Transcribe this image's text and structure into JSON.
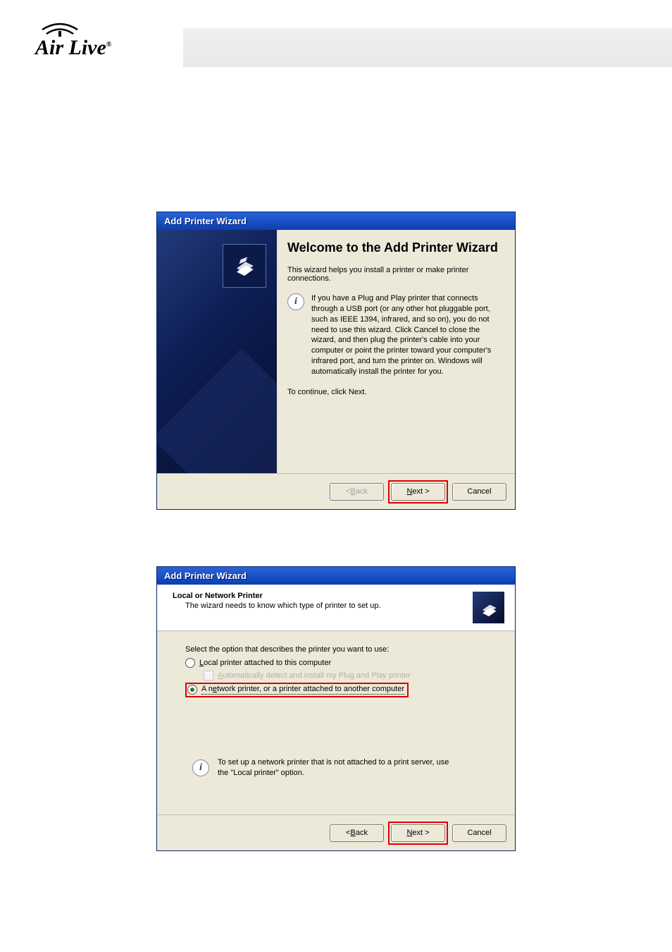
{
  "brand": {
    "name": "Air Live"
  },
  "dialog1": {
    "title": "Add Printer Wizard",
    "heading": "Welcome to the Add Printer Wizard",
    "intro": "This wizard helps you install a printer or make printer connections.",
    "info": "If you have a Plug and Play printer that connects through a USB port (or any other hot pluggable port, such as IEEE 1394, infrared, and so on), you do not need to use this wizard. Click Cancel to close the wizard, and then plug the printer's cable into your computer or point the printer toward your computer's infrared port, and turn the printer on. Windows will automatically install the printer for you.",
    "continue": "To continue, click Next.",
    "back": "< Back",
    "next": "Next >",
    "cancel": "Cancel"
  },
  "dialog2": {
    "title": "Add Printer Wizard",
    "subheader_title": "Local or Network Printer",
    "subheader_desc": "The wizard needs to know which type of printer to set up.",
    "prompt": "Select the option that describes the printer you want to use:",
    "opt_local": "Local printer attached to this computer",
    "opt_autodetect": "Automatically detect and install my Plug and Play printer",
    "opt_network": "A network printer, or a printer attached to another computer",
    "tip": "To set up a network printer that is not attached to a print server, use the \"Local printer\" option.",
    "back": "< Back",
    "next": "Next >",
    "cancel": "Cancel"
  }
}
